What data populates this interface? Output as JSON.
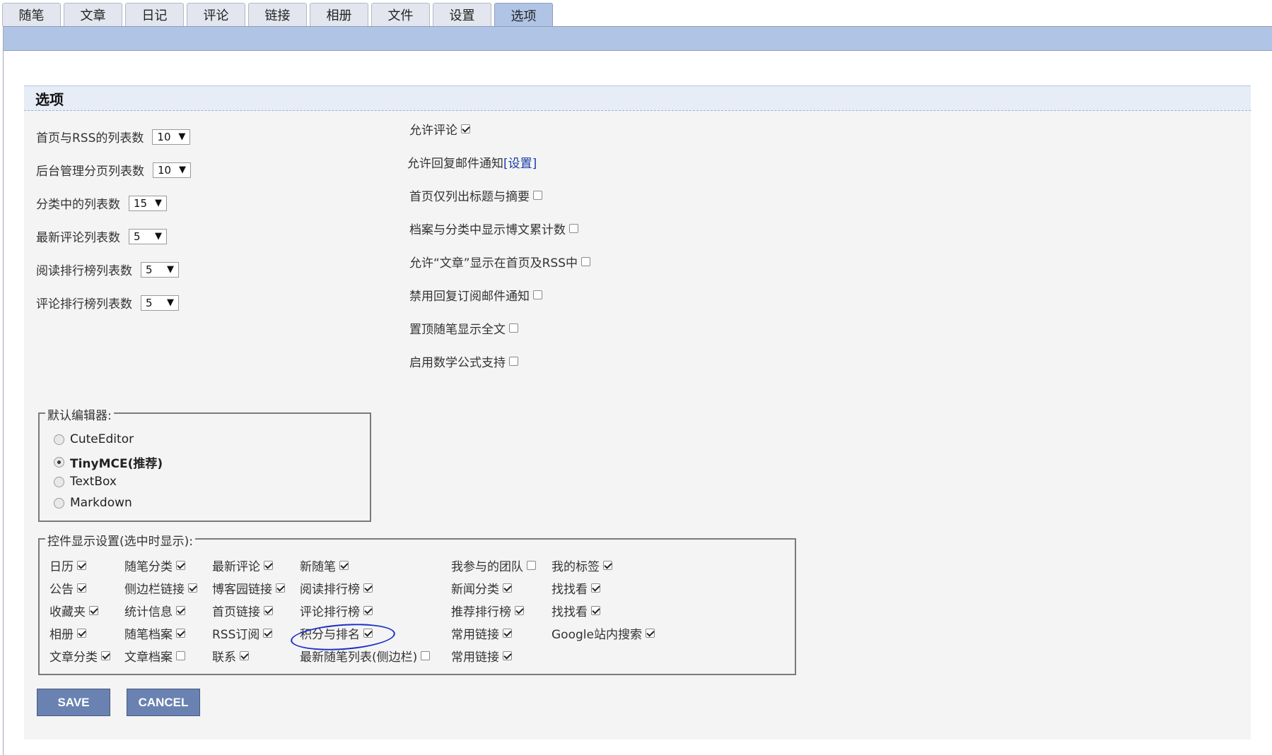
{
  "tabs": [
    "随笔",
    "文章",
    "日记",
    "评论",
    "链接",
    "相册",
    "文件",
    "设置",
    "选项"
  ],
  "active_tab": "选项",
  "panel_title": "选项",
  "list_settings": [
    {
      "label": "首页与RSS的列表数",
      "value": "10"
    },
    {
      "label": "后台管理分页列表数",
      "value": "10"
    },
    {
      "label": "分类中的列表数",
      "value": "15"
    },
    {
      "label": "最新评论列表数",
      "value": "5"
    },
    {
      "label": "阅读排行榜列表数",
      "value": "5"
    },
    {
      "label": "评论排行榜列表数",
      "value": "5"
    }
  ],
  "right_options": [
    {
      "label": "允许评论",
      "checked": true
    },
    {
      "label": "允许回复邮件通知",
      "link": "[设置]",
      "checked": null
    },
    {
      "label": "首页仅列出标题与摘要",
      "checked": false
    },
    {
      "label": "档案与分类中显示博文累计数",
      "checked": false
    },
    {
      "label": "允许“文章”显示在首页及RSS中",
      "checked": false
    },
    {
      "label": "禁用回复订阅邮件通知",
      "checked": false
    },
    {
      "label": "置顶随笔显示全文",
      "checked": false
    },
    {
      "label": "启用数学公式支持",
      "checked": false
    }
  ],
  "editor": {
    "legend": "默认编辑器:",
    "options": [
      {
        "label": "CuteEditor",
        "selected": false
      },
      {
        "label": "TinyMCE(推荐)",
        "selected": true
      },
      {
        "label": "TextBox",
        "selected": false
      },
      {
        "label": "Markdown",
        "selected": false
      }
    ]
  },
  "controls": {
    "legend": "控件显示设置(选中时显示):",
    "col1": [
      {
        "label": "日历",
        "checked": true
      },
      {
        "label": "公告",
        "checked": true
      },
      {
        "label": "收藏夹",
        "checked": true
      },
      {
        "label": "相册",
        "checked": true
      },
      {
        "label": "文章分类",
        "checked": true
      }
    ],
    "col2": [
      {
        "label": "随笔分类",
        "checked": true
      },
      {
        "label": "侧边栏链接",
        "checked": true
      },
      {
        "label": "统计信息",
        "checked": true
      },
      {
        "label": "随笔档案",
        "checked": true
      },
      {
        "label": "文章档案",
        "checked": false
      }
    ],
    "col3": [
      {
        "label": "最新评论",
        "checked": true
      },
      {
        "label": "博客园链接",
        "checked": true
      },
      {
        "label": "首页链接",
        "checked": true
      },
      {
        "label": "RSS订阅",
        "checked": true
      },
      {
        "label": "联系",
        "checked": true
      }
    ],
    "col4": [
      {
        "label": "新随笔",
        "checked": true
      },
      {
        "label": "阅读排行榜",
        "checked": true
      },
      {
        "label": "评论排行榜",
        "checked": true
      },
      {
        "label": "积分与排名",
        "checked": true
      },
      {
        "label": "最新随笔列表(侧边栏)",
        "checked": false
      }
    ],
    "col5": [
      {
        "label": "我参与的团队",
        "checked": false
      },
      {
        "label": "新闻分类",
        "checked": true
      },
      {
        "label": "推荐排行榜",
        "checked": true
      },
      {
        "label": "常用链接",
        "checked": true
      },
      {
        "label": "常用链接",
        "checked": true
      }
    ],
    "col6": [
      {
        "label": "我的标签",
        "checked": true
      },
      {
        "label": "找找看",
        "checked": true
      },
      {
        "label": "找找看",
        "checked": true
      },
      {
        "label": "Google站内搜索",
        "checked": true
      }
    ]
  },
  "buttons": {
    "save": "SAVE",
    "cancel": "CANCEL"
  },
  "annotation_color": "#1a2fc7"
}
